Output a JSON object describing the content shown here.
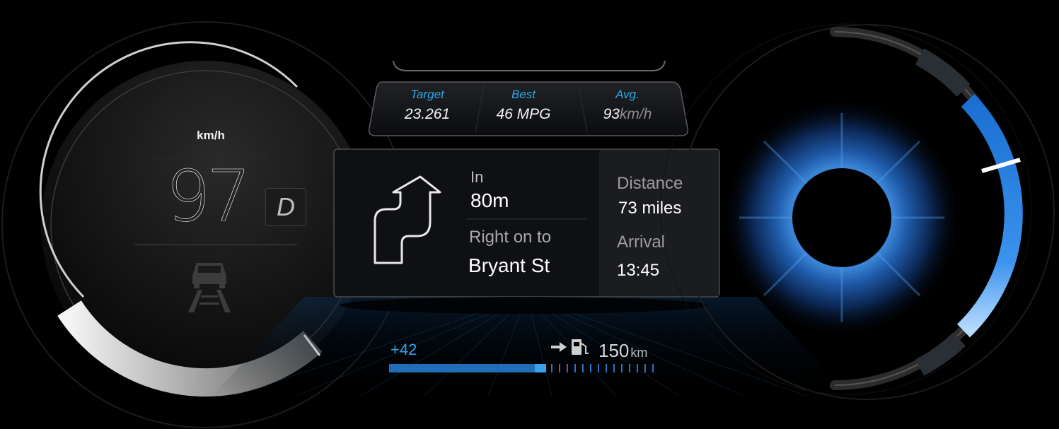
{
  "speedometer": {
    "unit": "km/h",
    "speed": "97",
    "gear": "D",
    "speed_arc_fraction": 0.4,
    "mode_icon": "car-lane-icon"
  },
  "trip_stats": {
    "target": {
      "label": "Target",
      "value": "23.261"
    },
    "best": {
      "label": "Best",
      "value": "46 MPG"
    },
    "avg": {
      "label": "Avg.",
      "value": "93",
      "unit": "km/h"
    }
  },
  "navigation": {
    "turn_icon": "winding-road-right-arrow-icon",
    "in_label": "In",
    "in_distance": "80m",
    "direction": "Right on to",
    "street": "Bryant St",
    "distance_label": "Distance",
    "distance_value": "73 miles",
    "arrival_label": "Arrival",
    "arrival_value": "13:45"
  },
  "range": {
    "delta": "+42",
    "fuel_icon": "fuel-pump-icon",
    "arrow_icon": "arrow-right-icon",
    "value": "150",
    "unit": "km",
    "fill_fraction": 0.59
  },
  "power_gauge": {
    "level_fraction": 0.72,
    "accent": "#2a8de4"
  },
  "colors": {
    "accent": "#2fa6e6",
    "background": "#000000"
  }
}
